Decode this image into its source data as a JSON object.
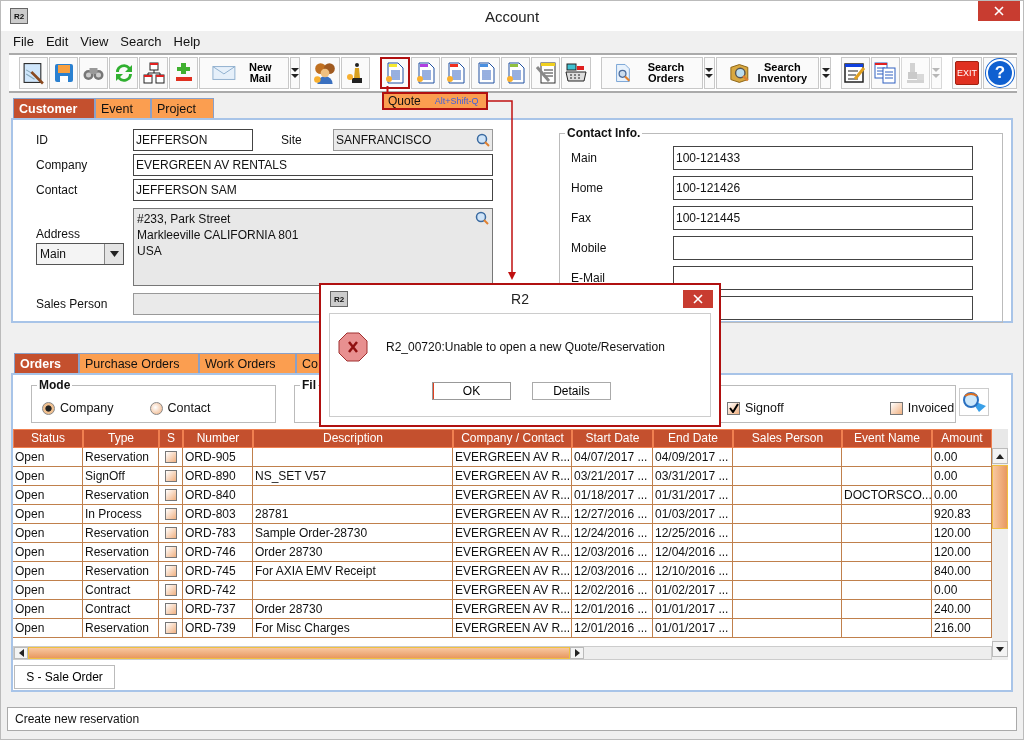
{
  "window": {
    "title": "Account",
    "logo": "R2"
  },
  "menu": [
    {
      "label": "File"
    },
    {
      "label": "Edit"
    },
    {
      "label": "View"
    },
    {
      "label": "Search"
    },
    {
      "label": "Help"
    }
  ],
  "toolbar": {
    "groups": [
      {
        "items": [
          {
            "kind": "icon",
            "selected": false,
            "disabled": false
          },
          {
            "kind": "icon",
            "selected": false,
            "disabled": false
          },
          {
            "kind": "icon",
            "selected": false,
            "disabled": false
          },
          {
            "kind": "icon",
            "selected": false,
            "disabled": false
          },
          {
            "kind": "icon",
            "selected": false,
            "disabled": false
          },
          {
            "kind": "icon",
            "selected": false,
            "disabled": false
          },
          {
            "kind": "labeled",
            "label": "New Mail",
            "selected": false,
            "disabled": false
          },
          {
            "kind": "dropdown",
            "selected": false,
            "disabled": false
          }
        ]
      },
      {
        "items": [
          {
            "kind": "icon",
            "selected": false,
            "disabled": false
          },
          {
            "kind": "icon",
            "selected": false,
            "disabled": false
          }
        ]
      },
      {
        "items": [
          {
            "kind": "icon",
            "selected": true,
            "disabled": false
          },
          {
            "kind": "icon",
            "selected": false,
            "disabled": false
          },
          {
            "kind": "icon",
            "selected": false,
            "disabled": false
          },
          {
            "kind": "icon",
            "selected": false,
            "disabled": false
          },
          {
            "kind": "icon",
            "selected": false,
            "disabled": false
          },
          {
            "kind": "icon",
            "selected": false,
            "disabled": false
          },
          {
            "kind": "icon",
            "selected": false,
            "disabled": false
          }
        ]
      },
      {
        "items": [
          {
            "kind": "labeled",
            "label": "Search Orders",
            "selected": false,
            "disabled": false
          },
          {
            "kind": "dropdown",
            "selected": false,
            "disabled": false
          },
          {
            "kind": "labeled",
            "label": "Search Inventory",
            "selected": false,
            "disabled": false
          },
          {
            "kind": "dropdown",
            "selected": false,
            "disabled": false
          }
        ]
      },
      {
        "items": [
          {
            "kind": "icon",
            "selected": false,
            "disabled": false
          },
          {
            "kind": "icon",
            "selected": false,
            "disabled": false
          },
          {
            "kind": "icon",
            "selected": false,
            "disabled": true
          },
          {
            "kind": "dropdown",
            "selected": false,
            "disabled": true
          }
        ]
      },
      {
        "items": [
          {
            "kind": "exit",
            "label": "EXIT",
            "selected": false,
            "disabled": false
          },
          {
            "kind": "round",
            "label": "?",
            "selected": false,
            "disabled": false
          }
        ]
      }
    ]
  },
  "tooltip": {
    "title": "Quote",
    "shortcut": "Alt+Shift-Q"
  },
  "top_tabs": [
    {
      "label": "Customer",
      "selected": true
    },
    {
      "label": "Event",
      "selected": false
    },
    {
      "label": "Project",
      "selected": false
    }
  ],
  "customer": {
    "id": {
      "label": "ID",
      "value": "JEFFERSON"
    },
    "site": {
      "label": "Site",
      "value": "SANFRANCISCO"
    },
    "company": {
      "label": "Company",
      "value": "EVERGREEN AV RENTALS"
    },
    "contact": {
      "label": "Contact",
      "value": "JEFFERSON SAM"
    },
    "address": {
      "label": "Address",
      "type": "Main",
      "lines": [
        "#233, Park Street",
        "Markleeville CALIFORNIA 801",
        "USA"
      ]
    },
    "sales_person": {
      "label": "Sales Person"
    }
  },
  "contact_info": {
    "title": "Contact Info.",
    "fields": [
      {
        "kind": "labeled",
        "label": "Main",
        "value": "100-121433"
      },
      {
        "kind": "labeled",
        "label": "Home",
        "value": "100-121426"
      },
      {
        "kind": "labeled",
        "label": "Fax",
        "value": "100-121445"
      },
      {
        "kind": "labeled",
        "label": "Mobile"
      },
      {
        "kind": "labeled",
        "label": "E-Mail"
      },
      {
        "kind": "unlabeled"
      }
    ]
  },
  "bottom_tabs": [
    {
      "label": "Orders",
      "selected": true
    },
    {
      "label": "Purchase Orders",
      "selected": false
    },
    {
      "label": "Work Orders",
      "selected": false
    },
    {
      "label": "Co",
      "selected": false
    }
  ],
  "mode": {
    "title": "Mode",
    "options": [
      {
        "label": "Company",
        "selected": true
      },
      {
        "label": "Contact",
        "selected": false
      }
    ]
  },
  "filter": {
    "title": "Fil",
    "options": [
      {
        "label": "Signoff",
        "checked": true
      },
      {
        "label": "Invoiced",
        "checked": false
      }
    ]
  },
  "table": {
    "columns": [
      "Status",
      "Type",
      "S",
      "Number",
      "Description",
      "Company / Contact",
      "Start Date",
      "End Date",
      "Sales Person",
      "Event Name",
      "Amount"
    ],
    "rows": [
      {
        "status": "Open",
        "type": "Reservation",
        "checked": false,
        "number": "ORD-905",
        "company": "EVERGREEN AV R...",
        "start_date": "04/07/2017 ...",
        "end_date": "04/09/2017 ...",
        "amount": "0.00"
      },
      {
        "status": "Open",
        "type": "SignOff",
        "checked": false,
        "number": "ORD-890",
        "description": "NS_SET V57",
        "company": "EVERGREEN AV R...",
        "start_date": "03/21/2017 ...",
        "end_date": "03/31/2017 ...",
        "amount": "0.00"
      },
      {
        "status": "Open",
        "type": "Reservation",
        "checked": false,
        "number": "ORD-840",
        "company": "EVERGREEN AV R...",
        "start_date": "01/18/2017 ...",
        "end_date": "01/31/2017 ...",
        "event_name": "DOCTORSCO...",
        "amount": "0.00"
      },
      {
        "status": "Open",
        "type": "In Process",
        "checked": false,
        "number": "ORD-803",
        "description": "28781",
        "company": "EVERGREEN AV R...",
        "start_date": "12/27/2016 ...",
        "end_date": "01/03/2017 ...",
        "amount": "920.83"
      },
      {
        "status": "Open",
        "type": "Reservation",
        "checked": false,
        "number": "ORD-783",
        "description": "Sample Order-28730",
        "company": "EVERGREEN AV R...",
        "start_date": "12/24/2016 ...",
        "end_date": "12/25/2016 ...",
        "amount": "120.00"
      },
      {
        "status": "Open",
        "type": "Reservation",
        "checked": false,
        "number": "ORD-746",
        "description": "Order 28730",
        "company": "EVERGREEN AV R...",
        "start_date": "12/03/2016 ...",
        "end_date": "12/04/2016 ...",
        "amount": "120.00"
      },
      {
        "status": "Open",
        "type": "Reservation",
        "checked": false,
        "number": "ORD-745",
        "description": "For AXIA EMV Receipt",
        "company": "EVERGREEN AV R...",
        "start_date": "12/03/2016 ...",
        "end_date": "12/10/2016 ...",
        "amount": "840.00"
      },
      {
        "status": "Open",
        "type": "Contract",
        "checked": false,
        "number": "ORD-742",
        "company": "EVERGREEN AV R...",
        "start_date": "12/02/2016 ...",
        "end_date": "01/02/2017 ...",
        "amount": "0.00"
      },
      {
        "status": "Open",
        "type": "Contract",
        "checked": false,
        "number": "ORD-737",
        "description": "Order 28730",
        "company": "EVERGREEN AV R...",
        "start_date": "12/01/2016 ...",
        "end_date": "01/01/2017 ...",
        "amount": "240.00"
      },
      {
        "status": "Open",
        "type": "Reservation",
        "checked": false,
        "number": "ORD-739",
        "description": "For Misc Charges",
        "company": "EVERGREEN AV R...",
        "start_date": "12/01/2016 ...",
        "end_date": "01/01/2017 ...",
        "amount": "216.00"
      }
    ]
  },
  "footer_tabs": [
    {
      "label": "S - Sale Order"
    }
  ],
  "status_bar": "Create new reservation",
  "dialog": {
    "logo": "R2",
    "title": "R2",
    "message": "R2_00720:Unable to open a new Quote/Reservation",
    "buttons": [
      {
        "label": "OK",
        "focused": true
      },
      {
        "label": "Details",
        "focused": false
      }
    ]
  }
}
